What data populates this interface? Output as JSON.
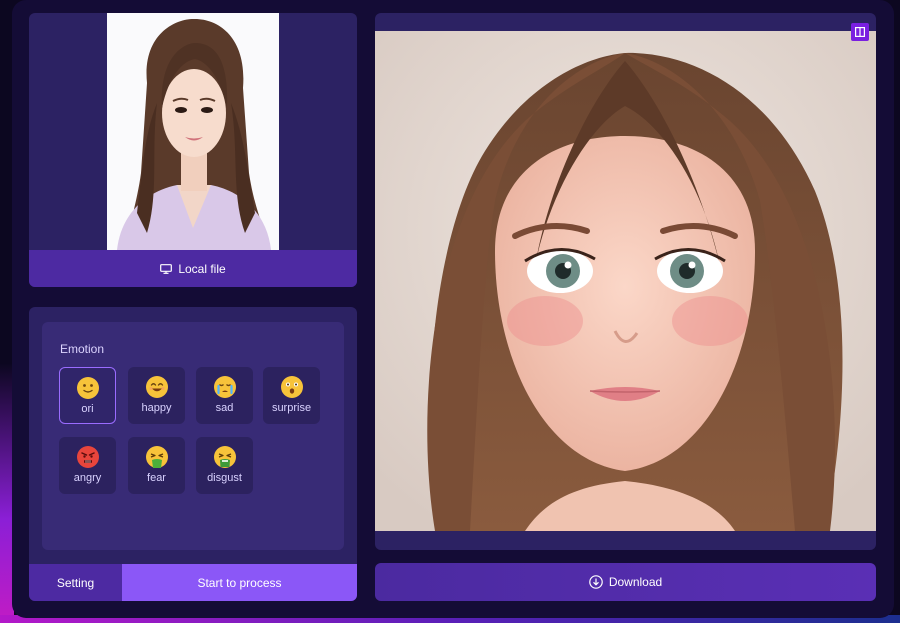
{
  "source": {
    "upload_label": "Local file",
    "upload_icon": "monitor-icon"
  },
  "emotion": {
    "title": "Emotion",
    "options": [
      {
        "label": "ori",
        "icon": "slightly-smiling-face-icon",
        "selected": true
      },
      {
        "label": "happy",
        "icon": "smiling-face-icon",
        "selected": false
      },
      {
        "label": "sad",
        "icon": "crying-face-icon",
        "selected": false
      },
      {
        "label": "surprise",
        "icon": "surprised-face-icon",
        "selected": false
      },
      {
        "label": "angry",
        "icon": "angry-face-icon",
        "selected": false
      },
      {
        "label": "fear",
        "icon": "vomiting-face-icon",
        "selected": false
      },
      {
        "label": "disgust",
        "icon": "nauseated-face-icon",
        "selected": false
      }
    ]
  },
  "footer": {
    "setting_label": "Setting",
    "process_label": "Start to process"
  },
  "result": {
    "download_label": "Download",
    "download_icon": "download-circle-icon",
    "compare_icon": "split-view-icon"
  },
  "colors": {
    "accent": "#8b57f7",
    "panel": "#2c2263",
    "button": "#4d2aa2"
  }
}
